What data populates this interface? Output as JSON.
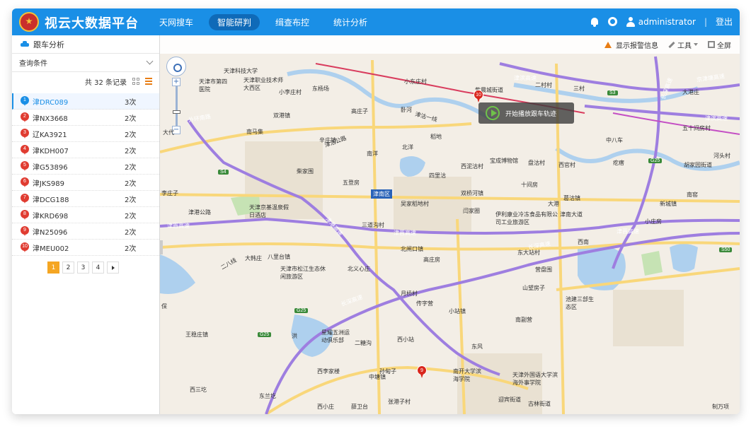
{
  "header": {
    "brand": "视云大数据平台",
    "nav": [
      "天网搜车",
      "智能研判",
      "缉查布控",
      "统计分析"
    ],
    "active_nav": 1,
    "user": "administrator",
    "separator": "|",
    "logout": "登出"
  },
  "sidebar": {
    "title": "跟车分析",
    "query_label": "查询条件",
    "record_count": "共 32 条记录",
    "rows": [
      {
        "num": "1",
        "plate": "津DRC089",
        "times": "3次"
      },
      {
        "num": "2",
        "plate": "津NX3668",
        "times": "2次"
      },
      {
        "num": "3",
        "plate": "辽KA3921",
        "times": "2次"
      },
      {
        "num": "4",
        "plate": "津KDH007",
        "times": "2次"
      },
      {
        "num": "5",
        "plate": "津G53896",
        "times": "2次"
      },
      {
        "num": "6",
        "plate": "津JKS989",
        "times": "2次"
      },
      {
        "num": "7",
        "plate": "津DCG188",
        "times": "2次"
      },
      {
        "num": "8",
        "plate": "津KRD698",
        "times": "2次"
      },
      {
        "num": "9",
        "plate": "津N25096",
        "times": "2次"
      },
      {
        "num": "10",
        "plate": "津MEU002",
        "times": "2次"
      }
    ],
    "pages": [
      "1",
      "2",
      "3",
      "4"
    ],
    "active_page": "1"
  },
  "map": {
    "tools": {
      "alarm": "显示报警信息",
      "tools": "工具",
      "fullscreen": "全屏"
    },
    "play_tip": "开始播放跟车轨迹",
    "markers": [
      {
        "label": "10"
      },
      {
        "label": "9"
      }
    ],
    "district": "津南区",
    "shields": [
      "S4",
      "S3",
      "G25",
      "G25",
      "S50",
      "G25"
    ],
    "roads": [
      "外环南路",
      "津滨高速",
      "京津塘高速",
      "津滨高速",
      "津港高速",
      "津晋高速",
      "津晋高速",
      "津晋高速",
      "长深高速",
      "长深高速",
      "长深高速",
      "津沽公路",
      "津港公路",
      "二八线",
      "津南大道",
      "津沽一线"
    ],
    "labels": [
      "天津科技大学",
      "天津市第四医院",
      "天津职业技术师大西区",
      "小李庄村",
      "东杨场",
      "紫晨城街道",
      "小东庄村",
      "二村村",
      "三村",
      "大港庄",
      "双港镇",
      "高庄子",
      "卧河",
      "南马集",
      "辛庄镇",
      "稻地",
      "中八车",
      "五十间房村",
      "南洋",
      "北洋",
      "柴家围",
      "五登房",
      "四里沽",
      "西泥沽村",
      "宝成博物馆",
      "盘沽村",
      "西官村",
      "疙瘩",
      "胡家园街道",
      "河头村",
      "天津京基温泉假日酒店",
      "吴家稻地村",
      "十间房",
      "大港",
      "葛沽镇",
      "新城镇",
      "南窑",
      "三道沟村",
      "双桥河镇",
      "伊利康业冷冻食品有限公司工业旅游区",
      "闫家圈",
      "小庄房",
      "八里台镇",
      "北闸口镇",
      "高庄房",
      "东大站村",
      "西南",
      "大韩庄",
      "天津市松江生态休闲旅游区",
      "北义心庄",
      "营盘围",
      "月桥村",
      "山望房子",
      "传字营",
      "小站镇",
      "池建三部生态区",
      "王稳庄镇",
      "星耀五洲运动俱乐部",
      "二糖沟",
      "西小站",
      "南副营",
      "东风",
      "南开大学滨海学院",
      "天津外国语大学滨海外事学院",
      "西李家楼",
      "中塘镇",
      "孙甸子",
      "西三圪",
      "东兰圪",
      "西小庄",
      "薛卫台",
      "张港子村",
      "古林街道",
      "迎宾街道",
      "制万项",
      "李庄子",
      "大代",
      "保",
      "洪"
    ]
  }
}
